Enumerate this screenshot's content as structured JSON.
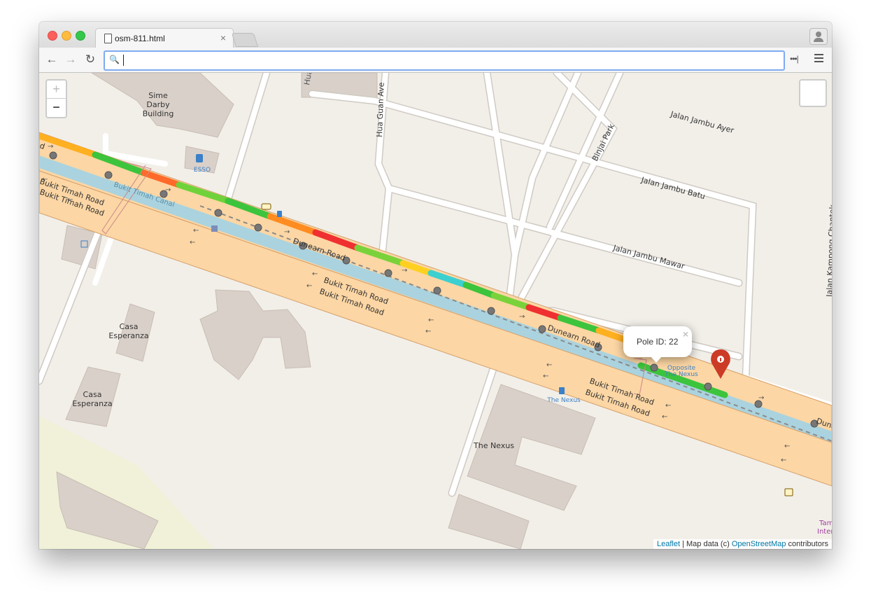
{
  "tab": {
    "title": "osm-811.html"
  },
  "url": {
    "value": ""
  },
  "map": {
    "zoom_in_label": "+",
    "zoom_out_label": "−",
    "labels": {
      "sime_darby": "Sime",
      "sime_darby_2": "Darby",
      "sime_darby_3": "Building",
      "esso": "ESSO",
      "hua_guan_ave": "Hua Guan Ave",
      "binjai_park": "Binjai Park",
      "jambu_ayer": "Jalan Jambu Ayer",
      "jambu_batu": "Jalan Jambu Batu",
      "jambu_mawar": "Jalan Jambu Mawar",
      "kampong": "Jalan Kampong Chantek",
      "bt_road_1": "Bukit Timah Road",
      "bt_road_2": "Bukit Timah Road",
      "bt_canal": "Bukit Timah Canal",
      "dunearn_1": "Dunearn Road",
      "dunearn_2": "Dunearn Road",
      "dunearn_3": "Dune",
      "dunearn_left": "d",
      "bt_center_1": "Bukit Timah Road",
      "bt_center_2": "Bukit Timah Road",
      "bt_right_1": "Bukit Timah Road",
      "bt_right_2": "Bukit Timah Road",
      "casa_1": "Casa",
      "casa_1b": "Esperanza",
      "casa_2": "Casa",
      "casa_2b": "Esperanza",
      "the_nexus_bus": "The Nexus",
      "the_nexus": "The Nexus",
      "opp_nexus_1": "Opposite",
      "opp_nexus_2": "The Nexus",
      "hua_guan_top": "Hua G",
      "tam": "Tam",
      "inter": "Inter"
    },
    "popup": {
      "text": "Pole ID: 22",
      "close": "×"
    },
    "attribution": {
      "leaflet": "Leaflet",
      "mid": " | Map data (c) ",
      "osm": "OpenStreetMap",
      "end": " contributors"
    }
  },
  "colors": {
    "road_major": "#fcd6a4",
    "road_casing": "#d5a06b",
    "canal": "#aad3df",
    "building": "#d9d0c9",
    "background": "#f2efe9",
    "marker": "#cc3b26"
  }
}
